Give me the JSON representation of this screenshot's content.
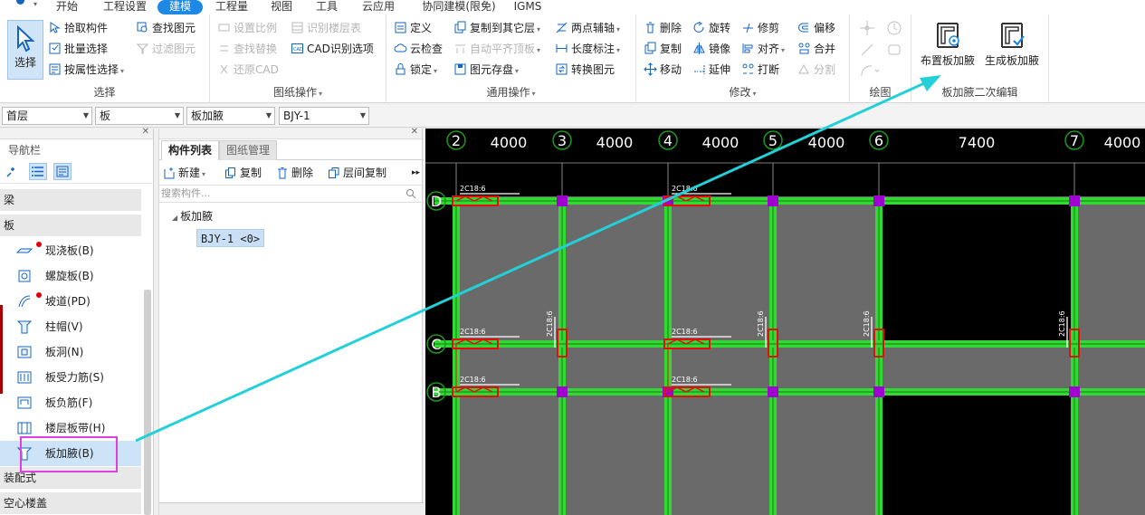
{
  "menu": {
    "items": [
      "开始",
      "工程设置",
      "建模",
      "工程量",
      "视图",
      "工具",
      "云应用",
      "协同建模(限免)",
      "IGMS"
    ],
    "active_index": 2
  },
  "ribbon": {
    "select_group": {
      "big_label": "选择",
      "buttons": [
        "拾取构件",
        "批量选择",
        "按属性选择"
      ],
      "group_label": "选择"
    },
    "drawing_group": {
      "buttons": [
        "设置比例",
        "识别楼层表",
        "查找替换",
        "CAD识别选项",
        "还原CAD"
      ],
      "find_label": "查找图元",
      "filter_label": "过滤图元",
      "group_label": "图纸操作"
    },
    "common_group": {
      "buttons": [
        "定义",
        "复制到其它层",
        "两点辅轴",
        "云检查",
        "自动平齐顶板",
        "长度标注",
        "锁定",
        "图元存盘",
        "转换图元"
      ],
      "group_label": "通用操作"
    },
    "modify_group": {
      "buttons": [
        "删除",
        "旋转",
        "修剪",
        "偏移",
        "复制",
        "镜像",
        "对齐",
        "合并",
        "移动",
        "延伸",
        "打断",
        "分割"
      ],
      "group_label": "修改"
    },
    "draw_group": {
      "group_label": "绘图"
    },
    "haunch_group": {
      "buttons": [
        "布置板加腋",
        "生成板加腋"
      ],
      "group_label": "板加腋二次编辑"
    }
  },
  "combos": [
    "首层",
    "板",
    "板加腋",
    "BJY-1"
  ],
  "nav": {
    "title": "导航栏",
    "categories": [
      "梁",
      "板",
      "装配式",
      "空心楼盖"
    ],
    "items": [
      {
        "label": "现浇板(B)",
        "dot": true
      },
      {
        "label": "螺旋板(B)",
        "dot": false
      },
      {
        "label": "坡道(PD)",
        "dot": true
      },
      {
        "label": "柱帽(V)",
        "dot": false
      },
      {
        "label": "板洞(N)",
        "dot": false
      },
      {
        "label": "板受力筋(S)",
        "dot": false
      },
      {
        "label": "板负筋(F)",
        "dot": false
      },
      {
        "label": "楼层板带(H)",
        "dot": false
      },
      {
        "label": "板加腋(B)",
        "dot": false,
        "selected": true
      }
    ]
  },
  "component_list": {
    "tabs": [
      "构件列表",
      "图纸管理"
    ],
    "toolbar": [
      "新建",
      "复制",
      "删除",
      "层间复制"
    ],
    "search_placeholder": "搜索构件...",
    "tree_root": "板加腋",
    "tree_leaf": "BJY-1 <0>"
  },
  "canvas": {
    "axis_numbers": [
      "2",
      "3",
      "4",
      "5",
      "6",
      "7"
    ],
    "spacings": [
      "4000",
      "4000",
      "4000",
      "4000",
      "7400",
      "4000"
    ],
    "row_labels": [
      "D",
      "C",
      "B"
    ],
    "rebar_label": "2C18:6"
  },
  "colors": {
    "accent": "#1e88e5",
    "beam": "#33d933",
    "slab": "#6a6a6a",
    "column": "#a000d0",
    "haunch": "#e01010",
    "arrow": "#24d0d8",
    "highlight": "#e040e0"
  }
}
